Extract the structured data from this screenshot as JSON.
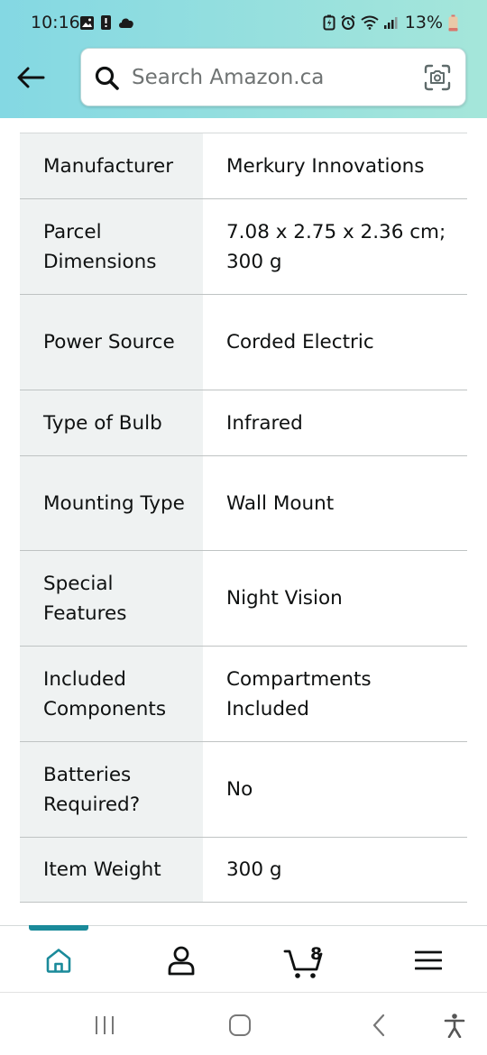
{
  "status_bar": {
    "time": "10:16",
    "battery": "13%"
  },
  "search": {
    "placeholder": "Search Amazon.ca",
    "value": ""
  },
  "details": [
    {
      "label": "Manufacturer",
      "value": "Merkury Innovations"
    },
    {
      "label": "Parcel Dimensions",
      "value": "7.08 x 2.75 x 2.36 cm; 300 g"
    },
    {
      "label": "Power Source",
      "value": "Corded Electric"
    },
    {
      "label": "Type of Bulb",
      "value": "Infrared"
    },
    {
      "label": "Mounting Type",
      "value": "Wall Mount"
    },
    {
      "label": "Special Features",
      "value": "Night Vision"
    },
    {
      "label": "Included Components",
      "value": "Compartments Included"
    },
    {
      "label": "Batteries Required?",
      "value": "No"
    },
    {
      "label": "Item Weight",
      "value": "300 g"
    }
  ],
  "bottom_nav": {
    "cart_count": "8",
    "active_item": "home",
    "accent_color": "#1a8a9a"
  },
  "icons": {
    "back": "arrow-left-icon",
    "search": "magnifier-icon",
    "camera": "camera-scan-icon",
    "home": "home-icon",
    "account": "person-icon",
    "cart": "cart-icon",
    "menu": "hamburger-icon"
  }
}
